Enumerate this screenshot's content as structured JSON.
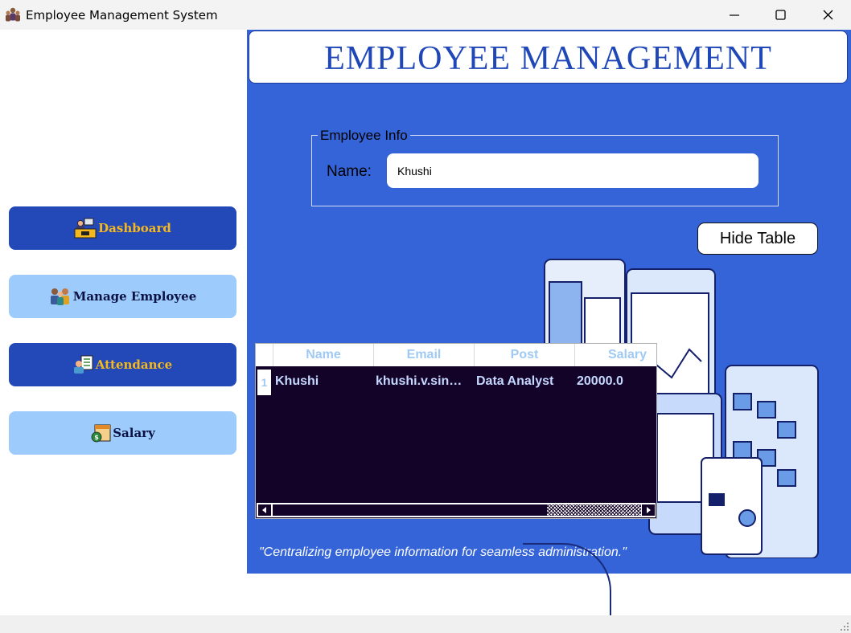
{
  "window": {
    "title": "Employee Management System",
    "icon": "people-group-icon",
    "controls": [
      "minimize-icon",
      "maximize-icon",
      "close-icon"
    ]
  },
  "sidebar": {
    "items": [
      {
        "label": "Dashboard",
        "icon": "dashboard-desk-icon",
        "style": "dark"
      },
      {
        "label": "Manage Employee",
        "icon": "employees-icon",
        "style": "light"
      },
      {
        "label": "Attendance",
        "icon": "attendance-icon",
        "style": "dark"
      },
      {
        "label": "Salary",
        "icon": "salary-calendar-icon",
        "style": "light"
      }
    ]
  },
  "header": {
    "title": "EMPLOYEE MANAGEMENT"
  },
  "employee_info": {
    "legend": "Employee Info",
    "name_label": "Name:",
    "name_value": "Khushi"
  },
  "hide_table_button": "Hide Table",
  "table": {
    "columns": [
      "Name",
      "Email",
      "Post",
      "Salary"
    ],
    "rows": [
      {
        "row_number": "1",
        "cells": [
          "Khushi",
          "khushi.v.sin…",
          "Data Analyst",
          "20000.0"
        ]
      }
    ]
  },
  "tagline": "\"Centralizing employee information for seamless administration.\"",
  "colors": {
    "main_background": "#3464d8",
    "nav_dark": "#2348b8",
    "nav_light": "#9dcbfb",
    "nav_dark_text": "#f5b81d",
    "header_text": "#1f47b8",
    "table_background": "#130329"
  }
}
